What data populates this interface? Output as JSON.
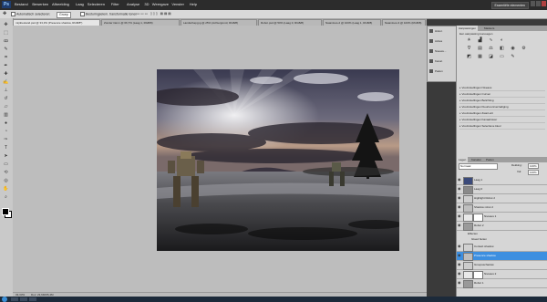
{
  "app": {
    "logo": "Ps",
    "workspace_button": "Essentiële elementen"
  },
  "menu": [
    "Bestand",
    "Bewerken",
    "Afbeelding",
    "Laag",
    "Selecteren",
    "Filter",
    "Analyse",
    "3D",
    "Weergave",
    "Venster",
    "Help"
  ],
  "options_bar": {
    "auto_select": "Automatisch selecteren:",
    "auto_select_value": "Groep",
    "show_transform": "Besturingselem. transformatie tonen"
  },
  "tabs": [
    {
      "label": "mijnbestand.psd @ 33,3% (Presence shadow, RGB/8*)",
      "active": true
    },
    {
      "label": "Zonder titel-1 @ 66,7% (Laag 1, RGB/8)",
      "active": false
    },
    {
      "label": "Landschap.jpg @ 25% (Achtergrond, RGB/8)",
      "active": false
    },
    {
      "label": "Robot.psd @ 50% (Laag 0, RGB/8)",
      "active": false
    },
    {
      "label": "Naamloos-2 @ 100% (Laag 1, RGB/8)",
      "active": false
    },
    {
      "label": "Naamloos-3 @ 100% (RGB/8)",
      "active": false
    }
  ],
  "status": {
    "zoom": "33,33%",
    "doc": "Doc: 23,6M/95,4M"
  },
  "mini_panel": [
    "Histor.",
    "Acties",
    "Nieuwe...",
    "Kanal.",
    "Paden"
  ],
  "adjustments": {
    "tabs": [
      "Aanpassingen",
      "Maskers"
    ],
    "title": "Een aanpassing toevoegen",
    "presets": [
      "Voorinstellingen Niveaus",
      "Voorinstellingen Curven",
      "Voorinstellingen Belichting",
      "Voorinstellingen Kleurtoon/verzadiging",
      "Voorinstellingen Zwart-wit",
      "Voorinstellingen Kanaalmixer",
      "Voorinstellingen Selectieve kleur"
    ]
  },
  "layers": {
    "tabs": [
      "Lagen",
      "Kanalen",
      "Paden"
    ],
    "blend_mode": "Normaal",
    "opacity_label": "Dekking:",
    "opacity_value": "100%",
    "fill_label": "Vul:",
    "fill_value": "100%",
    "items": [
      {
        "name": "Laag 1",
        "selected": false,
        "thumb": "#3b4a7a",
        "mask": false
      },
      {
        "name": "Laag 0",
        "selected": false,
        "thumb": "#8a8a8a",
        "mask": false
      },
      {
        "name": "Highlight Robot 2",
        "selected": false,
        "thumb": "#cfcfcf",
        "mask": false
      },
      {
        "name": "Shadow robot 2",
        "selected": false,
        "thumb": "#bfbfbf",
        "mask": false
      },
      {
        "name": "Niveaus 1",
        "selected": false,
        "thumb": "#e8e8e8",
        "mask": true
      },
      {
        "name": "Robot 2",
        "selected": false,
        "thumb": "#9a9a9a",
        "mask": false
      },
      {
        "name": "Contact shadow",
        "selected": false,
        "thumb": "#d0d0d0",
        "mask": false
      },
      {
        "name": "Presence shadow",
        "selected": true,
        "thumb": "#bdbdbd",
        "mask": false
      },
      {
        "name": "Groepsschaduw",
        "selected": false,
        "thumb": "#cccccc",
        "mask": false
      },
      {
        "name": "Niveaus 2",
        "selected": false,
        "thumb": "#e8e8e8",
        "mask": true
      },
      {
        "name": "Robot 1",
        "selected": false,
        "thumb": "#999999",
        "mask": false
      }
    ],
    "effects_label": "Effecten",
    "effect": "Gloed buiten"
  }
}
